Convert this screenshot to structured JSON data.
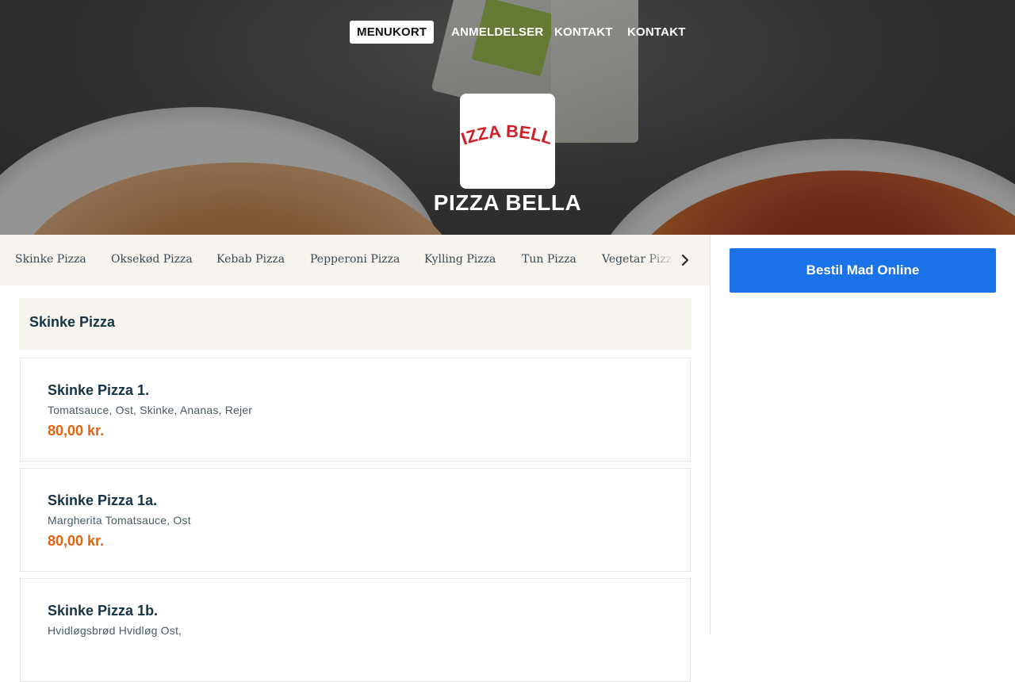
{
  "nav": {
    "items": [
      {
        "label": "MENUKORT",
        "active": true
      },
      {
        "label": "ANMELDELSER",
        "active": false
      },
      {
        "label": "KONTAKT",
        "active": false
      },
      {
        "label": "KONTAKT",
        "active": false
      }
    ]
  },
  "restaurant": {
    "logo_text": "PIZZA BELLA",
    "name": "PIZZA BELLA"
  },
  "categories": {
    "items": [
      "Skinke Pizza",
      "Oksekød Pizza",
      "Kebab Pizza",
      "Pepperoni Pizza",
      "Kylling Pizza",
      "Tun Pizza",
      "Vegetar Pizza"
    ],
    "next_icon": "chevron-right-icon"
  },
  "order": {
    "button_label": "Bestil Mad Online",
    "color": "#1a73e8"
  },
  "menu": {
    "section_title": "Skinke Pizza",
    "items": [
      {
        "name": "Skinke Pizza 1.",
        "description": "Tomatsauce, Ost, Skinke, Ananas, Rejer",
        "price": "80,00 kr."
      },
      {
        "name": "Skinke Pizza 1a.",
        "description": "Margherita Tomatsauce, Ost",
        "price": "80,00 kr."
      },
      {
        "name": "Skinke Pizza 1b.",
        "description": "Hvidløgsbrød Hvidløg Ost,",
        "price": ""
      }
    ],
    "price_color": "#e8620c"
  }
}
